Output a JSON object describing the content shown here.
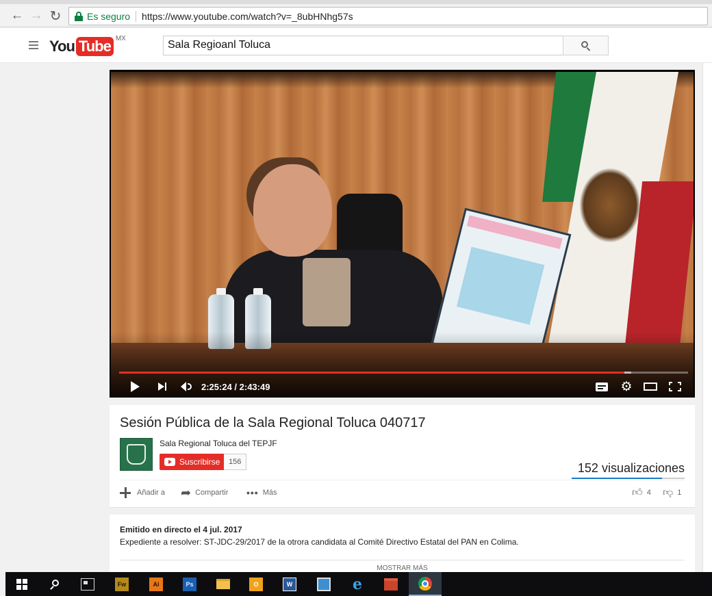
{
  "browser": {
    "secure_label": "Es seguro",
    "url": "https://www.youtube.com/watch?v=_8ubHNhg57s"
  },
  "header": {
    "logo_you": "You",
    "logo_tube": "Tube",
    "country": "MX",
    "search_value": "Sala Regioanl Toluca"
  },
  "player": {
    "current_time": "2:25:24",
    "duration": "2:43:49",
    "time_display": "2:25:24 / 2:43:49",
    "progress_fraction": 0.888,
    "buffer_fraction": 0.9
  },
  "video": {
    "title": "Sesión Pública de la Sala Regional Toluca 040717",
    "channel_name": "Sala Regional Toluca del TEPJF",
    "subscribe_label": "Suscribirse",
    "subscriber_count": "156",
    "views": "152 visualizaciones",
    "add_label": "Añadir a",
    "share_label": "Compartir",
    "more_label": "Más",
    "likes": "4",
    "dislikes": "1",
    "like_fraction": 0.8
  },
  "description": {
    "published": "Emitido en directo el 4 jul. 2017",
    "text": "Expediente a resolver: ST-JDC-29/2017 de la otrora candidata al Comité Directivo Estatal del PAN en Colima.",
    "show_more": "MOSTRAR MÁS"
  },
  "taskbar": {
    "fw": "Fw",
    "ai": "Ai",
    "ps": "Ps",
    "ol": "O",
    "w": "W",
    "ie": "e"
  },
  "colors": {
    "youtube_red": "#e52d27",
    "secure_green": "#0b8043",
    "like_blue": "#167ac6"
  }
}
